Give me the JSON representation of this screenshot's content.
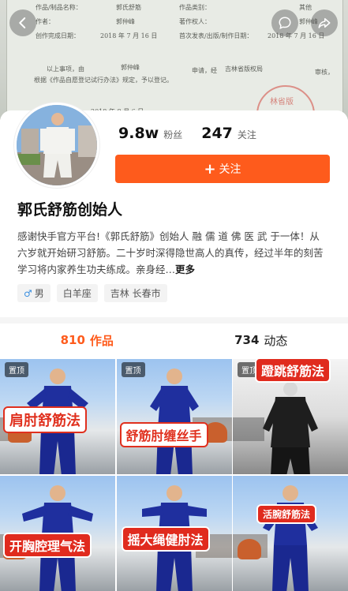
{
  "cover": {
    "fields": [
      {
        "label": "作品/制品名称：",
        "value": "郭氏舒筋",
        "label2": "作品类别：",
        "value2": "其他"
      },
      {
        "label": "作者：",
        "value": "郭仲峰",
        "label2": "著作权人：",
        "value2": "郭仲峰"
      },
      {
        "label": "创作完成日期：",
        "value": "2018 年 7 月 16 日",
        "label2": "首次发表/出版/制作日期：",
        "value2": "2018 年 7 月 16 日"
      }
    ],
    "note_line1": "以上事项，由",
    "note_name": "郭仲峰",
    "note_mid": "申请，经",
    "note_org": "吉林省版权局",
    "note_end": "审核，",
    "note_line2": "根据《作品自愿登记试行办法》规定，予以登记。",
    "date": "2018 年 8 月 6 日",
    "stamp_text": "林省版"
  },
  "profile": {
    "followers_num": "9.8w",
    "followers_label": "粉丝",
    "following_num": "247",
    "following_label": "关注",
    "follow_button": "关注",
    "name": "郭氏舒筋创始人",
    "bio": "感谢快手官方平台!《郭氏舒筋》创始人 融 儒 道 佛 医 武 于一体！从六岁就开始研习舒筋。二十岁时深得隐世高人的真传，经过半年的刻苦学习将内家养生功夫练成。亲身经…",
    "bio_more": "更多",
    "tags": [
      {
        "icon": "male-icon",
        "text": "男"
      },
      {
        "text": "白羊座"
      },
      {
        "text": "吉林 长春市"
      }
    ]
  },
  "tabs": [
    {
      "count": "810",
      "label": "作品",
      "active": true
    },
    {
      "count": "734",
      "label": "动态",
      "active": false
    }
  ],
  "videos": [
    {
      "pinned": "置顶",
      "title": "肩肘舒筋法",
      "style": "box"
    },
    {
      "pinned": "置顶",
      "title": "舒筋肘缠丝手",
      "style": "box"
    },
    {
      "pinned": "置顶",
      "title": "蹬跳舒筋法",
      "style": "red"
    },
    {
      "title": "开胸腔理气法",
      "style": "red"
    },
    {
      "title": "摇大绳健肘法",
      "style": "red"
    },
    {
      "title": "活腕舒筋法",
      "style": "red"
    }
  ],
  "colors": {
    "accent": "#fe5b1c",
    "title_red": "#e0301e",
    "suit_blue": "#1f2f9e"
  }
}
